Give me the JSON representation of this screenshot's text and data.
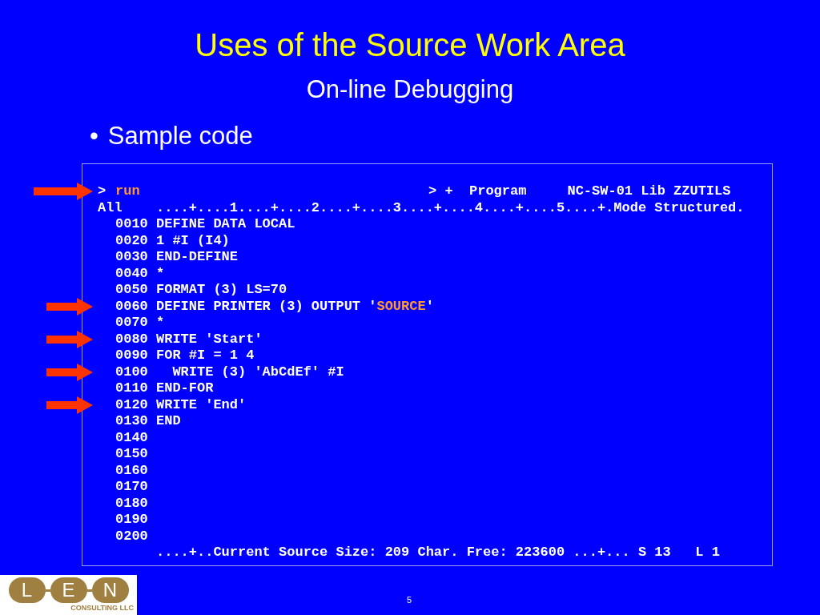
{
  "title": "Uses of the Source Work Area",
  "subtitle": "On-line Debugging",
  "bullet": {
    "marker": "•",
    "text": "Sample code"
  },
  "terminal": {
    "prompt": ">",
    "command": "run",
    "command_arrow": true,
    "header": "> +  Program     NC-SW-01 Lib ZZUTILS",
    "scope": "All",
    "ruler": "....+....1....+....2....+....3....+....4....+....5....+.Mode Structured.",
    "lines": [
      {
        "number": "0010",
        "arrow": false,
        "segments": [
          {
            "kind": "plain",
            "text": "DEFINE DATA LOCAL"
          }
        ]
      },
      {
        "number": "0020",
        "arrow": false,
        "segments": [
          {
            "kind": "plain",
            "text": "1 #I (I4)"
          }
        ]
      },
      {
        "number": "0030",
        "arrow": false,
        "segments": [
          {
            "kind": "plain",
            "text": "END-DEFINE"
          }
        ]
      },
      {
        "number": "0040",
        "arrow": false,
        "segments": [
          {
            "kind": "plain",
            "text": "*"
          }
        ]
      },
      {
        "number": "0050",
        "arrow": false,
        "segments": [
          {
            "kind": "plain",
            "text": "FORMAT (3) LS=70"
          }
        ]
      },
      {
        "number": "0060",
        "arrow": true,
        "segments": [
          {
            "kind": "plain",
            "text": "DEFINE PRINTER (3) OUTPUT '"
          },
          {
            "kind": "highlight",
            "text": "SOURCE"
          },
          {
            "kind": "plain",
            "text": "'"
          }
        ]
      },
      {
        "number": "0070",
        "arrow": false,
        "segments": [
          {
            "kind": "plain",
            "text": "*"
          }
        ]
      },
      {
        "number": "0080",
        "arrow": true,
        "segments": [
          {
            "kind": "plain",
            "text": "WRITE 'Start'"
          }
        ]
      },
      {
        "number": "0090",
        "arrow": false,
        "segments": [
          {
            "kind": "plain",
            "text": "FOR #I = 1 4"
          }
        ]
      },
      {
        "number": "0100",
        "arrow": true,
        "segments": [
          {
            "kind": "plain",
            "text": "  WRITE (3) 'AbCdEf' #I"
          }
        ]
      },
      {
        "number": "0110",
        "arrow": false,
        "segments": [
          {
            "kind": "plain",
            "text": "END-FOR"
          }
        ]
      },
      {
        "number": "0120",
        "arrow": true,
        "segments": [
          {
            "kind": "plain",
            "text": "WRITE 'End'"
          }
        ]
      },
      {
        "number": "0130",
        "arrow": false,
        "segments": [
          {
            "kind": "plain",
            "text": "END"
          }
        ]
      },
      {
        "number": "0140",
        "arrow": false
      },
      {
        "number": "0150",
        "arrow": false
      },
      {
        "number": "0160",
        "arrow": false
      },
      {
        "number": "0170",
        "arrow": false
      },
      {
        "number": "0180",
        "arrow": false
      },
      {
        "number": "0190",
        "arrow": false
      },
      {
        "number": "0200",
        "arrow": false
      }
    ],
    "status": "....+..Current Source Size: 209 Char. Free: 223600 ...+... S 13   L 1"
  },
  "logo": {
    "letters": [
      "L",
      "E",
      "N"
    ],
    "tagline": "CONSULTING LLC"
  },
  "page_number": "5"
}
